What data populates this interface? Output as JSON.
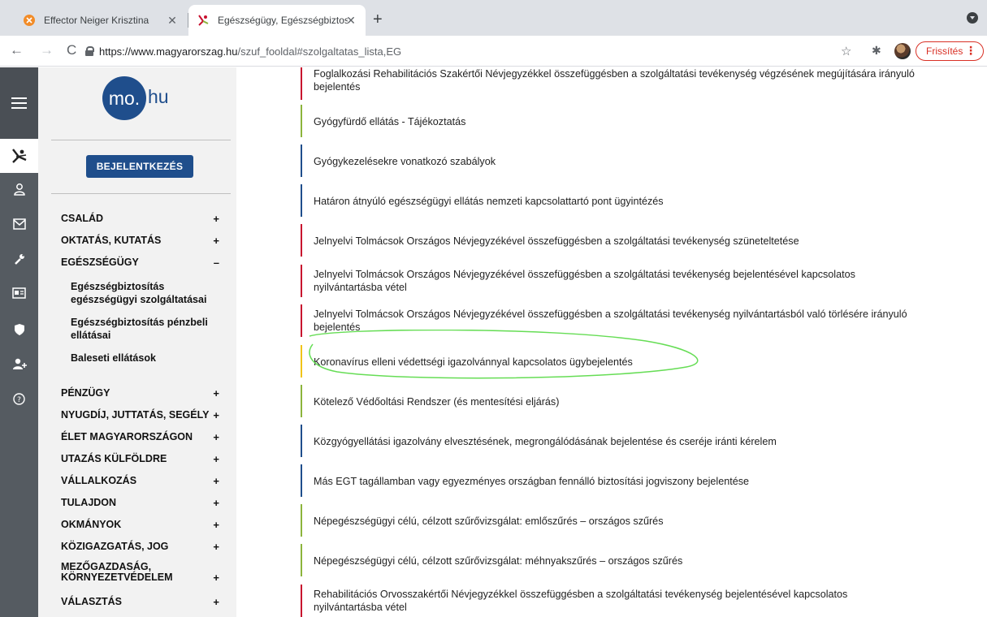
{
  "browser": {
    "tabs": [
      {
        "title": "Effector Neiger Krisztina",
        "icon": "orange-favicon-icon"
      },
      {
        "title": "Egészségügy, Egészségbiztosítás",
        "icon": "mohu-favicon-icon"
      }
    ],
    "url_domain": "https://www.magyarorszag.hu",
    "url_path": "/szuf_fooldal#szolgaltatas_lista,EG",
    "refresh_label": "Frissítés",
    "accent": "#d93025"
  },
  "sidebar": {
    "logo_text": "mo.",
    "logo_suffix": "hu",
    "login_label": "BEJELENTKEZÉS",
    "brand_color": "#1f4e8c",
    "menu": [
      {
        "label": "CSALÁD",
        "sign": "+"
      },
      {
        "label": "OKTATÁS, KUTATÁS",
        "sign": "+"
      },
      {
        "label": "EGÉSZSÉGÜGY",
        "sign": "–"
      },
      {
        "label": "PÉNZÜGY",
        "sign": "+"
      },
      {
        "label": "NYUGDÍJ, JUTTATÁS, SEGÉLY",
        "sign": "+"
      },
      {
        "label": "ÉLET MAGYARORSZÁGON",
        "sign": "+"
      },
      {
        "label": "UTAZÁS KÜLFÖLDRE",
        "sign": "+"
      },
      {
        "label": "VÁLLALKOZÁS",
        "sign": "+"
      },
      {
        "label": "TULAJDON",
        "sign": "+"
      },
      {
        "label": "OKMÁNYOK",
        "sign": "+"
      },
      {
        "label": "KÖZIGAZGATÁS, JOG",
        "sign": "+"
      },
      {
        "label": "MEZŐGAZDASÁG,\nKÖRNYEZETVÉDELEM",
        "sign": "+"
      },
      {
        "label": "VÁLASZTÁS",
        "sign": "+"
      }
    ],
    "submenu": [
      {
        "label": "Egészségbiztosítás egészségügyi szolgáltatásai"
      },
      {
        "label": "Egészségbiztosítás pénzbeli ellátásai"
      },
      {
        "label": "Baleseti ellátások"
      }
    ]
  },
  "services": [
    {
      "text": "Foglalkozási Rehabilitációs Szakértői Névjegyzékkel összefüggésben a szolgáltatási tevékenység végzésének megújítására irányuló\nbejelentés",
      "color": "#c8102e"
    },
    {
      "text": "Gyógyfürdő ellátás - Tájékoztatás",
      "color": "#8cb43c"
    },
    {
      "text": "Gyógykezelésekre vonatkozó szabályok",
      "color": "#1f4e8c"
    },
    {
      "text": "Határon átnyúló egészségügyi ellátás nemzeti kapcsolattartó pont ügyintézés",
      "color": "#1f4e8c"
    },
    {
      "text": "Jelnyelvi Tolmácsok Országos Névjegyzékével összefüggésben a szolgáltatási tevékenység szüneteltetése",
      "color": "#c8102e"
    },
    {
      "text": "Jelnyelvi Tolmácsok Országos Névjegyzékével összefüggésben a szolgáltatási tevékenység bejelentésével kapcsolatos\nnyilvántartásba vétel",
      "color": "#c8102e"
    },
    {
      "text": "Jelnyelvi Tolmácsok Országos Névjegyzékével összefüggésben a szolgáltatási tevékenység nyilvántartásból való törlésére irányuló\nbejelentés",
      "color": "#c8102e"
    },
    {
      "text": "Koronavírus elleni védettségi igazolvánnyal kapcsolatos ügybejelentés",
      "color": "#f0c419"
    },
    {
      "text": "Kötelező Védőoltási Rendszer (és mentesítési eljárás)",
      "color": "#8cb43c"
    },
    {
      "text": "Közgyógyellátási igazolvány elvesztésének, megrongálódásának bejelentése és cseréje iránti kérelem",
      "color": "#1f4e8c"
    },
    {
      "text": "Más EGT tagállamban vagy egyezményes országban fennálló biztosítási jogviszony bejelentése",
      "color": "#1f4e8c"
    },
    {
      "text": "Népegészségügyi célú, célzott szűrővizsgálat: emlőszűrés – országos szűrés",
      "color": "#8cb43c"
    },
    {
      "text": "Népegészségügyi célú, célzott szűrővizsgálat: méhnyakszűrés – országos szűrés",
      "color": "#8cb43c"
    },
    {
      "text": "Rehabilitációs Orvosszakértői Névjegyzékkel összefüggésben a szolgáltatási tevékenység bejelentésével kapcsolatos\nnyilvántartásba vétel",
      "color": "#c8102e"
    }
  ],
  "annotation_color": "#66dd55"
}
